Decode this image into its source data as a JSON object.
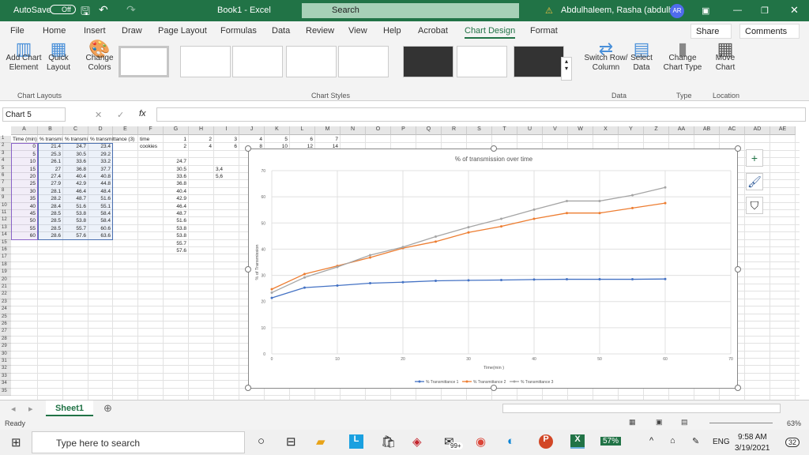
{
  "titlebar": {
    "autosave": "AutoSave",
    "autosave_state": "Off",
    "title": "Book1 - Excel",
    "search": "Search",
    "user": "Abdulhaleem, Rasha (abdulhrr)",
    "avatar": "AR"
  },
  "tabs": [
    "File",
    "Home",
    "Insert",
    "Draw",
    "Page Layout",
    "Formulas",
    "Data",
    "Review",
    "View",
    "Help",
    "Acrobat",
    "Chart Design",
    "Format"
  ],
  "active_tab": "Chart Design",
  "share": "Share",
  "comments": "Comments",
  "ribbon": {
    "add_chart_element": "Add Chart Element",
    "quick_layout": "Quick Layout",
    "change_colors": "Change Colors",
    "switch_row_col": "Switch Row/ Column",
    "select_data": "Select Data",
    "change_chart_type": "Change Chart Type",
    "move_chart": "Move Chart",
    "groups": {
      "layouts": "Chart Layouts",
      "styles": "Chart Styles",
      "data": "Data",
      "type": "Type",
      "location": "Location"
    }
  },
  "name_box": "Chart 5",
  "fx": "fx",
  "formula": "",
  "columns": [
    "A",
    "B",
    "C",
    "D",
    "E",
    "F",
    "G",
    "H",
    "I",
    "J",
    "K",
    "L",
    "M",
    "N",
    "O",
    "P",
    "Q",
    "R",
    "S",
    "T",
    "U",
    "V",
    "W",
    "X",
    "Y",
    "Z",
    "AA",
    "AB",
    "AC",
    "AD",
    "AE"
  ],
  "cells": {
    "A1": "Time (min)",
    "B1": "% transmi",
    "C1": "% transmi",
    "D1": "% transmittance (3)",
    "F1": "time",
    "G1": "1",
    "H1": "2",
    "I1": "3",
    "J1": "4",
    "K1": "5",
    "L1": "6",
    "M1": "7",
    "F2": "cookies",
    "G2": "2",
    "H2": "4",
    "I2": "6",
    "J2": "8",
    "K2": "10",
    "L2": "12",
    "M2": "14",
    "A2": "0",
    "B2": "21.4",
    "C2": "24.7",
    "D2": "23.4",
    "A3": "5",
    "B3": "25.3",
    "C3": "30.5",
    "D3": "29.2",
    "A4": "10",
    "B4": "26.1",
    "C4": "33.6",
    "D4": "33.2",
    "G4": "24.7",
    "A5": "15",
    "B5": "27",
    "C5": "36.8",
    "D5": "37.7",
    "G5": "30.5",
    "I5": "3,4",
    "A6": "20",
    "B6": "27.4",
    "C6": "40.4",
    "D6": "40.8",
    "G6": "33.6",
    "I6": "5,6",
    "A7": "25",
    "B7": "27.9",
    "C7": "42.9",
    "D7": "44.8",
    "G7": "36.8",
    "A8": "30",
    "B8": "28.1",
    "C8": "46.4",
    "D8": "48.4",
    "G8": "40.4",
    "A9": "35",
    "B9": "28.2",
    "C9": "48.7",
    "D9": "51.6",
    "G9": "42.9",
    "A10": "40",
    "B10": "28.4",
    "C10": "51.6",
    "D10": "55.1",
    "G10": "46.4",
    "A11": "45",
    "B11": "28.5",
    "C11": "53.8",
    "D11": "58.4",
    "G11": "48.7",
    "A12": "50",
    "B12": "28.5",
    "C12": "53.8",
    "D12": "58.4",
    "G12": "51.6",
    "A13": "55",
    "B13": "28.5",
    "C13": "55.7",
    "D13": "60.6",
    "G13": "53.8",
    "A14": "60",
    "B14": "28.6",
    "C14": "57.6",
    "D14": "63.6",
    "G14": "53.8",
    "G15": "55.7",
    "G16": "57.6"
  },
  "chart_data": {
    "type": "line",
    "title": "% of transmission over time",
    "xlabel": "Time(min )",
    "ylabel": "% of Transmission",
    "xlim": [
      0,
      70
    ],
    "ylim": [
      0,
      70
    ],
    "xticks": [
      0,
      10,
      20,
      30,
      40,
      50,
      60,
      70
    ],
    "yticks": [
      0,
      10,
      20,
      30,
      40,
      50,
      60,
      70
    ],
    "grid": true,
    "legend": "bottom",
    "x": [
      0,
      5,
      10,
      15,
      20,
      25,
      30,
      35,
      40,
      45,
      50,
      55,
      60
    ],
    "series": [
      {
        "name": "% Transmittance 1",
        "color": "#4472c4",
        "values": [
          21.4,
          25.3,
          26.1,
          27,
          27.4,
          27.9,
          28.1,
          28.2,
          28.4,
          28.5,
          28.5,
          28.5,
          28.6
        ]
      },
      {
        "name": "% Transmittance 2",
        "color": "#ed7d31",
        "values": [
          24.7,
          30.5,
          33.6,
          36.8,
          40.4,
          42.9,
          46.4,
          48.7,
          51.6,
          53.8,
          53.8,
          55.7,
          57.6
        ]
      },
      {
        "name": "% Transmittance 3",
        "color": "#a5a5a5",
        "values": [
          23.4,
          29.2,
          33.2,
          37.7,
          40.8,
          44.8,
          48.4,
          51.6,
          55.1,
          58.4,
          58.4,
          60.6,
          63.6
        ]
      }
    ]
  },
  "sheet_tab": "Sheet1",
  "status": {
    "ready": "Ready",
    "zoom": "63%"
  },
  "taskbar": {
    "search": "Type here to search",
    "badge": "99+",
    "battery": "57%",
    "lang": "ENG",
    "time": "9:58 AM",
    "date": "3/19/2021",
    "notif": "32"
  }
}
